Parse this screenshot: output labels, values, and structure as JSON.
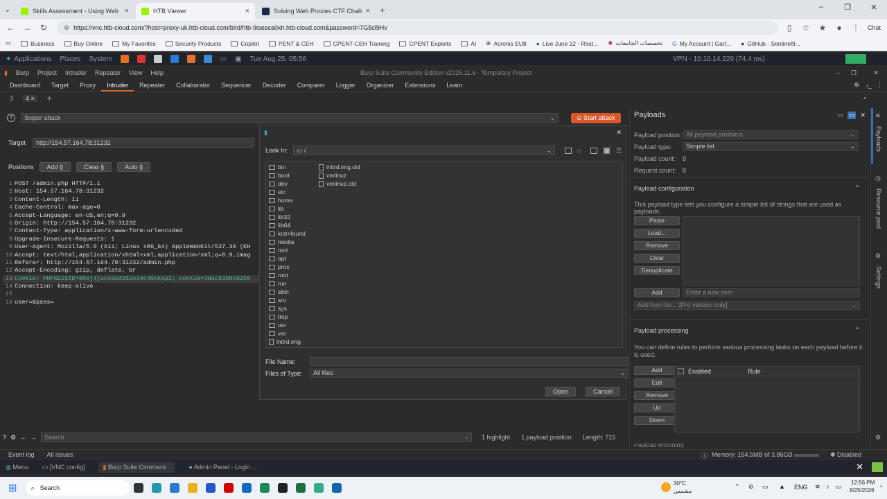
{
  "browser": {
    "tabs": [
      {
        "title": "Skills Assessment - Using Web Pro",
        "active": false
      },
      {
        "title": "HTB Viewer",
        "active": true
      },
      {
        "title": "Solving Web Proxies CTF Challeng",
        "active": false
      }
    ],
    "url": "https://vnc.htb-cloud.com/?host=proxy-uk.htb-cloud.com/bird/htb-9iseeca0xh.htb-cloud.com&password=7G5cl9Hv",
    "profile_label": "Chat",
    "bookmarks": [
      "Business",
      "Buy Online",
      "My Favorites",
      "Security Products",
      "Copilot",
      "PENT & CEH",
      "CPENT-CEH Training",
      "CPENT Exploits",
      "AI",
      "Acronis EU8",
      "Live June 12 - Rest...",
      "تخصصات الجامعات",
      "My Account | Gart...",
      "GitHub - Sentinel9..."
    ]
  },
  "desktop": {
    "applications": "Applications",
    "places": "Places",
    "system": "System",
    "clock": "Tue Aug 25, 05:56",
    "vpn": "VPN - 10.10.14.229 (74.4 ms)"
  },
  "burp": {
    "menu": [
      "Burp",
      "Project",
      "Intruder",
      "Repeater",
      "View",
      "Help"
    ],
    "title": "Burp Suite Community Edition v2025.11.6 - Temporary Project",
    "tabs": [
      "Dashboard",
      "Target",
      "Proxy",
      "Intruder",
      "Repeater",
      "Collaborator",
      "Sequencer",
      "Decoder",
      "Comparer",
      "Logger",
      "Organizer",
      "Extensions",
      "Learn"
    ],
    "active_tab": "Intruder",
    "subtabs": [
      "3",
      "4 ×",
      "+"
    ],
    "attack_type": "Sniper attack",
    "start_attack": "Start attack",
    "target_label": "Target",
    "target_value": "http://154.57.164.78:31232",
    "positions_label": "Positions",
    "add_btn": "Add §",
    "clear_btn": "Clear §",
    "auto_btn": "Auto §",
    "request_lines": [
      {
        "n": "1",
        "t": "POST /admin.php HTTP/1.1"
      },
      {
        "n": "2",
        "t": "Host: 154.57.164.78:31232"
      },
      {
        "n": "3",
        "t": "Content-Length: 11"
      },
      {
        "n": "4",
        "t": "Cache-Control: max-age=0"
      },
      {
        "n": "5",
        "t": "Accept-Language: en-US,en;q=0.9"
      },
      {
        "n": "6",
        "t": "Origin: http://154.57.164.78:31232"
      },
      {
        "n": "7",
        "t": "Content-Type: application/x-www-form-urlencoded"
      },
      {
        "n": "8",
        "t": "Upgrade-Insecure-Requests: 1"
      },
      {
        "n": "9",
        "t": "User-Agent: Mozilla/5.0 (X11; Linux x86_64) AppleWebKit/537.36 (KH"
      },
      {
        "n": "10",
        "t": "Accept: text/html,application/xhtml+xml,application/xml;q=0.9,imag"
      },
      {
        "n": "11",
        "t": "Referer: http://154.57.164.78:31232/admin.php"
      },
      {
        "n": "12",
        "t": "Accept-Encoding: gzip, deflate, br"
      },
      {
        "n": "13",
        "t": "Cookie: PHPSESSID=6h9j4juto3od282n34c45kkep2; cookie=3dac93b8cd250"
      },
      {
        "n": "14",
        "t": "Connection: keep-alive"
      },
      {
        "n": "15",
        "t": ""
      },
      {
        "n": "16",
        "t": "user=&pass="
      }
    ],
    "search_placeholder": "Search",
    "highlight": "1 highlight",
    "payload_position": "1 payload position",
    "length": "Length: 715",
    "event_log": "Event log",
    "all_issues": "All issues",
    "memory": "Memory: 154.5MB of 3.86GB",
    "disabled": "Disabled"
  },
  "dialog": {
    "look_in_label": "Look In:",
    "look_in_value": "/",
    "col1": [
      "bin",
      "boot",
      "dev",
      "etc",
      "home",
      "lib",
      "lib32",
      "lib64",
      "lost+found",
      "media",
      "mnt",
      "opt",
      "proc",
      "root",
      "run",
      "sbin",
      "srv",
      "sys",
      "tmp",
      "usr",
      "var",
      "initrd.img"
    ],
    "col1_files": [
      "initrd.img"
    ],
    "col2": [
      "initrd.img.old",
      "vmlinuz",
      "vmlinuz.old"
    ],
    "file_name_label": "File Name:",
    "file_name_value": "",
    "files_type_label": "Files of Type:",
    "files_type_value": "All files",
    "open": "Open",
    "cancel": "Cancel"
  },
  "payloads": {
    "title": "Payloads",
    "position_label": "Payload position:",
    "position_value": "All payload positions",
    "type_label": "Payload type:",
    "type_value": "Simple list",
    "count_label": "Payload count:",
    "count_value": "0",
    "request_label": "Request count:",
    "request_value": "0",
    "config_title": "Payload configuration",
    "config_desc": "This payload type lets you configure a simple list of strings that are used as payloads.",
    "buttons": [
      "Paste",
      "Load...",
      "Remove",
      "Clear",
      "Deduplicate"
    ],
    "add": "Add",
    "new_item_placeholder": "Enter a new item",
    "add_from_list": "Add from list... [Pro version only]",
    "processing_title": "Payload processing",
    "processing_desc": "You can define rules to perform various processing tasks on each payload before it is used.",
    "proc_buttons": [
      "Add",
      "Edit",
      "Remove",
      "Up",
      "Down"
    ],
    "col_enabled": "Enabled",
    "col_rule": "Rule",
    "payload_encoding": "Payload encoding"
  },
  "rail": {
    "payloads": "Payloads",
    "resource_pool": "Resource pool",
    "settings": "Settings"
  },
  "vnc_taskbar": [
    "Menu",
    "[VNC config]",
    "Burp Suite Communi...",
    "Admin Panel - Login ..."
  ],
  "windows": {
    "search": "Search",
    "weather_temp": "30°C",
    "weather_desc": "مشمس",
    "lang": "ENG",
    "time": "12:56 PM",
    "date": "8/25/2026"
  }
}
